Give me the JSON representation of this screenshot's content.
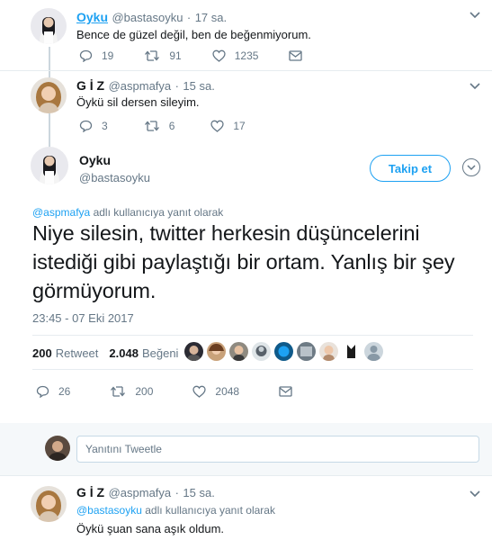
{
  "tweets": [
    {
      "name": "Oyku",
      "handle": "@bastasoyku",
      "sep": "·",
      "time": "17 sa.",
      "text": "Bence de güzel değil, ben de beğenmiyorum.",
      "replies": "19",
      "retweets": "91",
      "likes": "1235"
    },
    {
      "name": "G İ Z",
      "handle": "@aspmafya",
      "sep": "·",
      "time": "15 sa.",
      "text": "Öykü sil dersen sileyim.",
      "replies": "3",
      "retweets": "6",
      "likes": "17"
    }
  ],
  "main": {
    "name": "Oyku",
    "handle": "@bastasoyku",
    "follow_label": "Takip et",
    "reply_mention": "@aspmafya",
    "reply_context": "adlı kullanıcıya yanıt olarak",
    "text": "Niye silesin, twitter herkesin düşüncelerini istediği gibi paylaştığı bir ortam. Yanlış bir şey görmüyorum.",
    "timestamp": "23:45 - 07 Eki 2017",
    "retweet_count": "200",
    "retweet_label": "Retweet",
    "like_count": "2.048",
    "like_label": "Beğeni",
    "replies": "26",
    "retweets": "200",
    "likes": "2048"
  },
  "compose": {
    "placeholder": "Yanıtını Tweetle"
  },
  "bottom_tweet": {
    "name": "G İ Z",
    "handle": "@aspmafya",
    "sep": "·",
    "time": "15 sa.",
    "reply_mention": "@bastasoyku",
    "reply_context": "adlı kullanıcıya yanıt olarak",
    "text": "Öykü şuan sana aşık oldum."
  },
  "colors": {
    "accent": "#1da1f2",
    "muted": "#657786",
    "text": "#14171a",
    "divider": "#e6ecf0"
  },
  "icons": [
    "reply-icon",
    "retweet-icon",
    "like-icon",
    "dm-icon",
    "chevron-down-icon"
  ]
}
